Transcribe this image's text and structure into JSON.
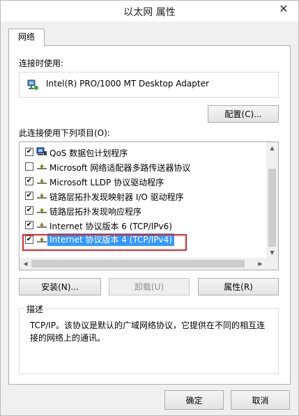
{
  "window": {
    "title": "以太网 属性",
    "close_glyph": "✕"
  },
  "tabs": [
    {
      "label": "网络"
    }
  ],
  "connect_using": {
    "label": "连接时使用:",
    "adapter_name": "Intel(R) PRO/1000 MT Desktop Adapter"
  },
  "buttons": {
    "configure": "配置(C)...",
    "install": "安装(N)...",
    "uninstall": "卸载(U)",
    "properties": "属性(R)",
    "ok": "确定",
    "cancel": "取消"
  },
  "items_label": "此连接使用下列项目(O):",
  "items": [
    {
      "label": "QoS 数据包计划程序",
      "checked": true,
      "icon": "qos-icon"
    },
    {
      "label": "Microsoft 网络适配器多路传送器协议",
      "checked": false,
      "icon": "protocol-icon"
    },
    {
      "label": "Microsoft LLDP 协议驱动程序",
      "checked": true,
      "icon": "protocol-icon"
    },
    {
      "label": "链路层拓扑发现映射器 I/O 驱动程序",
      "checked": true,
      "icon": "protocol-icon"
    },
    {
      "label": "链路层拓扑发现响应程序",
      "checked": true,
      "icon": "protocol-icon"
    },
    {
      "label": "Internet 协议版本 6 (TCP/IPv6)",
      "checked": true,
      "icon": "protocol-icon"
    },
    {
      "label": "Internet 协议版本 4 (TCP/IPv4)",
      "checked": true,
      "icon": "protocol-icon",
      "selected": true
    }
  ],
  "description": {
    "title": "描述",
    "text": "TCP/IP。该协议是默认的广域网络协议，它提供在不同的相互连接的网络上的通讯。"
  },
  "colors": {
    "selection": "#3399ff",
    "highlight_border": "#e0262b",
    "focus_border": "#3c7fb1"
  }
}
